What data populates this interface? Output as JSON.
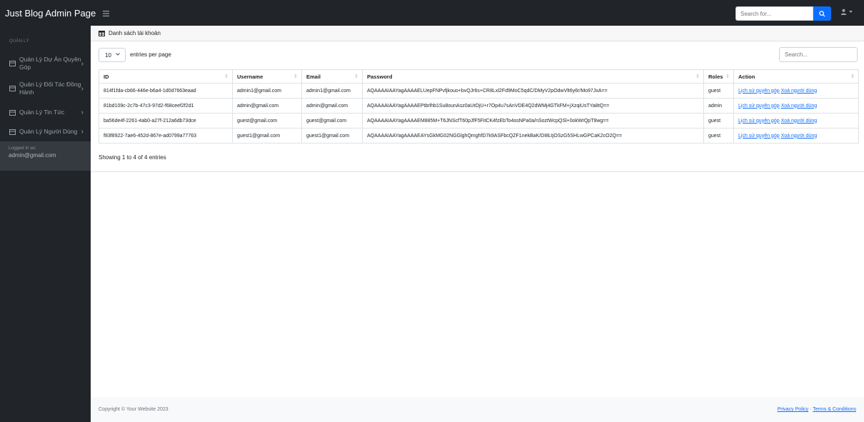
{
  "navbar": {
    "brand": "Just Blog Admin Page",
    "search_placeholder": "Search for..."
  },
  "sidebar": {
    "heading": "QUẢN LÝ",
    "items": [
      {
        "label": "Quản Lý Dự Án Quyên Góp"
      },
      {
        "label": "Quản Lý Đối Tác Đồng Hành"
      },
      {
        "label": "Quản Lý Tin Tức"
      },
      {
        "label": "Quản Lý Người Dùng"
      }
    ],
    "logged_in_label": "Logged in as:",
    "logged_in_user": "admin@gmail.com"
  },
  "card": {
    "title": "Danh sách tài khoản",
    "per_page_value": "10",
    "per_page_text": "entries per page",
    "search_placeholder": "Search...",
    "columns": [
      "ID",
      "Username",
      "Email",
      "Password",
      "Roles",
      "Action"
    ],
    "rows": [
      {
        "id": "814f1fda-cb66-446e-b6a4-1d0d7663eaad",
        "username": "admin1@gmail.com",
        "email": "admin1@gmail.com",
        "password": "AQAAAAIAAYagAAAAELUepFNPvfjkouo+bvQJr6s+CR8Lxl2Fd9MoC5qdC/DMyV2pOdwVlt6y6r/Mo97JxA==",
        "role": "guest",
        "action_history": "Lịch sử quyên góp",
        "action_delete": "Xoá người dùng"
      },
      {
        "id": "81bd109c-2c7b-47c3-97d2-f68ceef2f2d1",
        "username": "admin@gmail.com",
        "email": "admin@gmail.com",
        "password": "AQAAAAIAAYagAAAAEPtbrlhb1Su8ounAsz0aUtOjU+r7Op4u7sAnVDE4Q2dWMj4GTkFM+jXzqiUsTYa8tQ==",
        "role": "admin",
        "action_history": "Lịch sử quyên góp",
        "action_delete": "Xoá người dùng"
      },
      {
        "id": "ba56de4f-2261-4ab0-a27f-212a6db73dce",
        "username": "guest@gmail.com",
        "email": "guest@gmail.com",
        "password": "AQAAAAIAAYagAAAAEM885M+T6JNScfT60pJfF5FitCK4fzEbTo4osNPa0a/nSoztWcpQSl+0okWrQpT9wg==",
        "role": "guest",
        "action_history": "Lịch sử quyên góp",
        "action_delete": "Xoá người dùng"
      },
      {
        "id": "f83f8922-7ae6-452d-867e-ad0799a77763",
        "username": "guest1@gmail.com",
        "email": "guest1@gmail.com",
        "password": "AQAAAAIAAYagAAAAEAYsGkMG02NGGlghQmghfD7k9ASFbcQZF1nekBaK/DI8LtjOSzG5SHLwGPCaK2cO2Q==",
        "role": "guest",
        "action_history": "Lịch sử quyên góp",
        "action_delete": "Xoá người dùng"
      }
    ],
    "showing": "Showing 1 to 4 of 4 entries"
  },
  "footer": {
    "copyright": "Copyright © Your Website 2023",
    "privacy": "Privacy Policy",
    "separator": " · ",
    "terms": "Terms & Conditions"
  }
}
